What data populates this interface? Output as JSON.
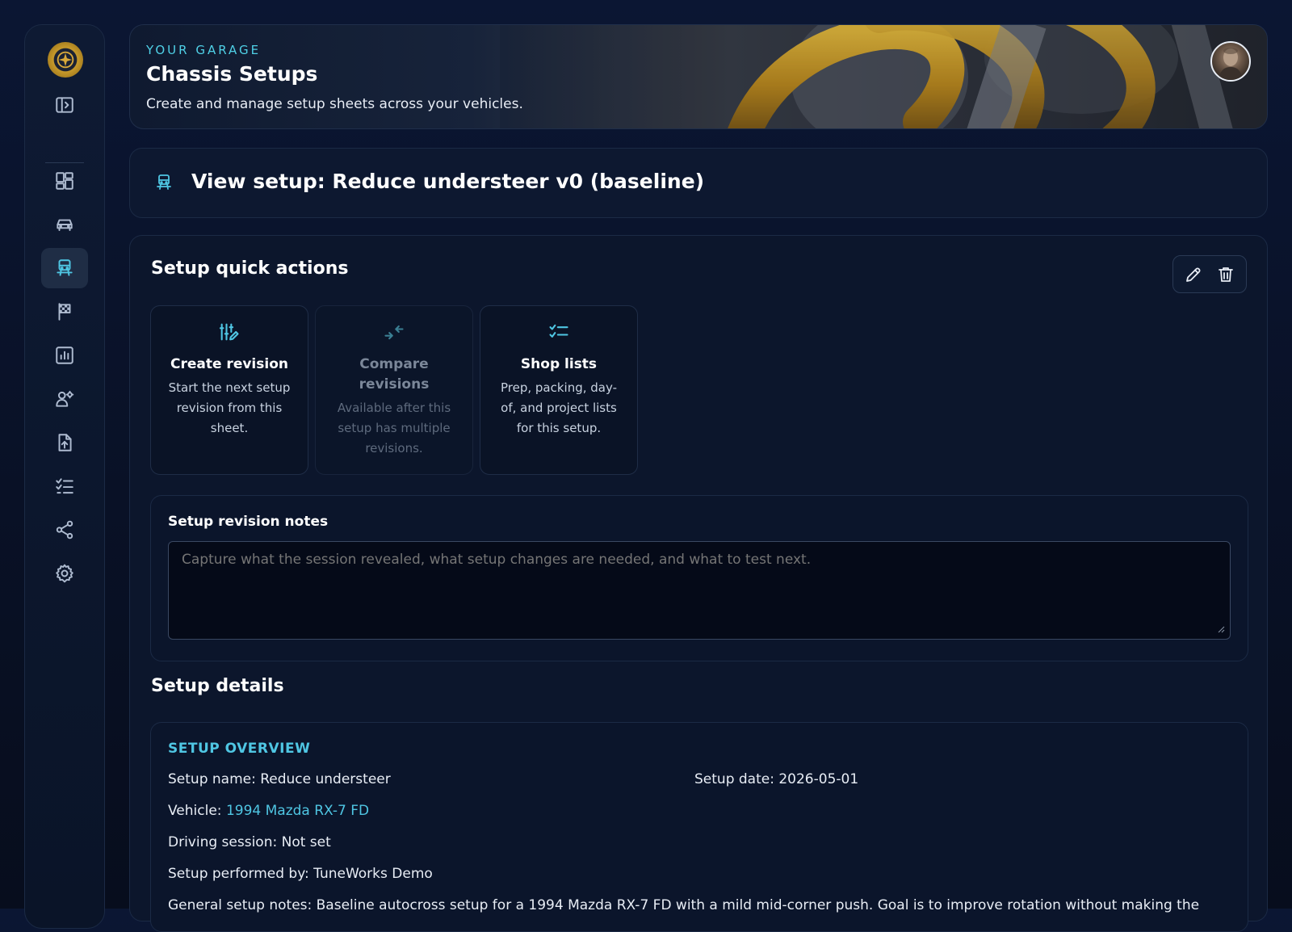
{
  "sidebar": {
    "items": [
      {
        "name": "logo-badge"
      },
      {
        "name": "collapse-sidebar"
      },
      {
        "name": "dashboard"
      },
      {
        "name": "vehicles"
      },
      {
        "name": "chassis-setups",
        "active": true
      },
      {
        "name": "events"
      },
      {
        "name": "reports"
      },
      {
        "name": "team"
      },
      {
        "name": "uploads"
      },
      {
        "name": "checklists"
      },
      {
        "name": "share"
      },
      {
        "name": "settings"
      }
    ]
  },
  "header": {
    "eyebrow": "YOUR GARAGE",
    "title": "Chassis Setups",
    "subtitle": "Create and manage setup sheets across your vehicles."
  },
  "view": {
    "title": "View setup: Reduce understeer v0 (baseline)"
  },
  "quick_actions": {
    "title": "Setup quick actions",
    "cards": [
      {
        "title": "Create revision",
        "desc": "Start the next setup revision from this sheet.",
        "enabled": true
      },
      {
        "title": "Compare revisions",
        "desc": "Available after this setup has multiple revisions.",
        "enabled": false
      },
      {
        "title": "Shop lists",
        "desc": "Prep, packing, day-of, and project lists for this setup.",
        "enabled": true
      }
    ]
  },
  "notes": {
    "label": "Setup revision notes",
    "placeholder": "Capture what the session revealed, what setup changes are needed, and what to test next.",
    "value": ""
  },
  "details": {
    "title": "Setup details",
    "overview_heading": "SETUP OVERVIEW",
    "setup_name": "Setup name: Reduce understeer",
    "setup_date": "Setup date: 2026-05-01",
    "vehicle_label": "Vehicle: ",
    "vehicle_link": "1994 Mazda RX-7 FD",
    "driving_session": "Driving session: Not set",
    "performed_by": "Setup performed by: TuneWorks Demo",
    "general_notes": "General setup notes: Baseline autocross setup for a 1994 Mazda RX-7 FD with a mild mid-corner push. Goal is to improve rotation without making the"
  },
  "colors": {
    "accent": "#4fc6e3",
    "background": "#091126",
    "card": "#0c162c"
  }
}
